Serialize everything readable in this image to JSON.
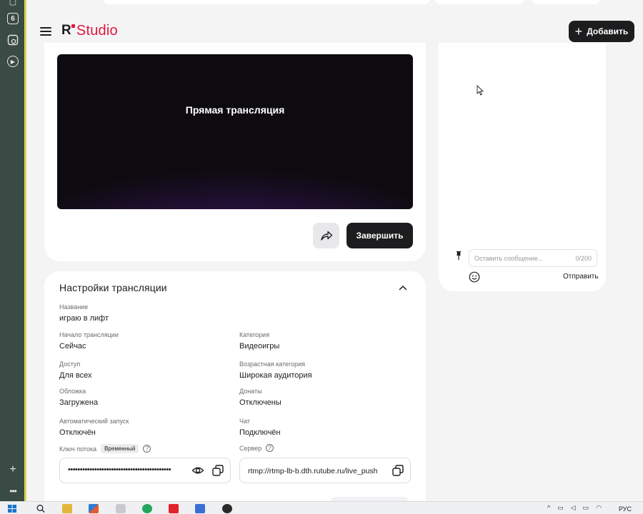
{
  "left_strip": {
    "badge_number": "6",
    "icons": [
      "browser-tab-icon",
      "tab-six-icon",
      "screenshot-icon",
      "play-icon",
      "plus-icon",
      "more-icon"
    ]
  },
  "header": {
    "logo_r": "R",
    "logo_studio": "Studio",
    "add_button_label": "Добавить"
  },
  "player": {
    "video_title": "Прямая трансляция",
    "finish_button_label": "Завершить"
  },
  "chat": {
    "input_placeholder": "Оставить сообщение...",
    "char_counter": "0/200",
    "send_label": "Отправить"
  },
  "settings": {
    "title": "Настройки трансляции",
    "fields": {
      "name": {
        "label": "Название",
        "value": "играю в лифт"
      },
      "start": {
        "label": "Начало трансляции",
        "value": "Сейчас"
      },
      "category": {
        "label": "Категория",
        "value": "Видеоигры"
      },
      "access": {
        "label": "Доступ",
        "value": "Для всех"
      },
      "age": {
        "label": "Возрастная категория",
        "value": "Широкая аудитория"
      },
      "cover": {
        "label": "Обложка",
        "value": "Загружена"
      },
      "donations": {
        "label": "Донаты",
        "value": "Отключены"
      },
      "autostart": {
        "label": "Автоматический запуск",
        "value": "Отключён"
      },
      "chat": {
        "label": "Чат",
        "value": "Подключён"
      }
    },
    "stream_key": {
      "label": "Ключ потока",
      "tag": "Временный",
      "masked_value": "•••••••••••••••••••••••••••••••••••••••••••"
    },
    "server": {
      "label": "Сервер",
      "value": "rtmp://rtmp-lb-b.dth.rutube.ru/live_push"
    }
  },
  "taskbar": {
    "language": "РУС"
  },
  "colors": {
    "brand_red": "#e3173e",
    "dark_button": "#1d1d1f",
    "page_bg": "#f4f4f5",
    "video_purple": "#4a1471"
  }
}
